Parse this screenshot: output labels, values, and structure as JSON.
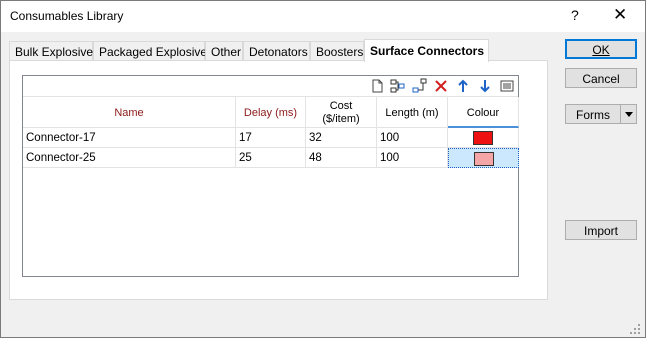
{
  "window": {
    "title": "Consumables Library",
    "help": "?",
    "close": "✕"
  },
  "tabs": [
    {
      "label": "Bulk Explosives"
    },
    {
      "label": "Packaged Explosives"
    },
    {
      "label": "Other"
    },
    {
      "label": "Detonators"
    },
    {
      "label": "Boosters"
    },
    {
      "label": "Surface Connectors",
      "active": true
    }
  ],
  "toolbar_icons": [
    "new-icon",
    "insert-row-icon",
    "append-row-icon",
    "delete-icon",
    "move-up-icon",
    "move-down-icon",
    "list-icon"
  ],
  "grid": {
    "columns": [
      {
        "label": "Name"
      },
      {
        "label": "Delay (ms)"
      },
      {
        "label_line1": "Cost",
        "label_line2": "($/item)"
      },
      {
        "label": "Length (m)"
      },
      {
        "label": "Colour"
      }
    ],
    "rows": [
      {
        "name": "Connector-17",
        "delay": "17",
        "cost": "32",
        "length": "100",
        "colour": "#ee1111"
      },
      {
        "name": "Connector-25",
        "delay": "25",
        "cost": "48",
        "length": "100",
        "colour": "#f4a6a6"
      }
    ]
  },
  "buttons": {
    "ok": "OK",
    "cancel": "Cancel",
    "forms": "Forms",
    "import": "Import"
  }
}
